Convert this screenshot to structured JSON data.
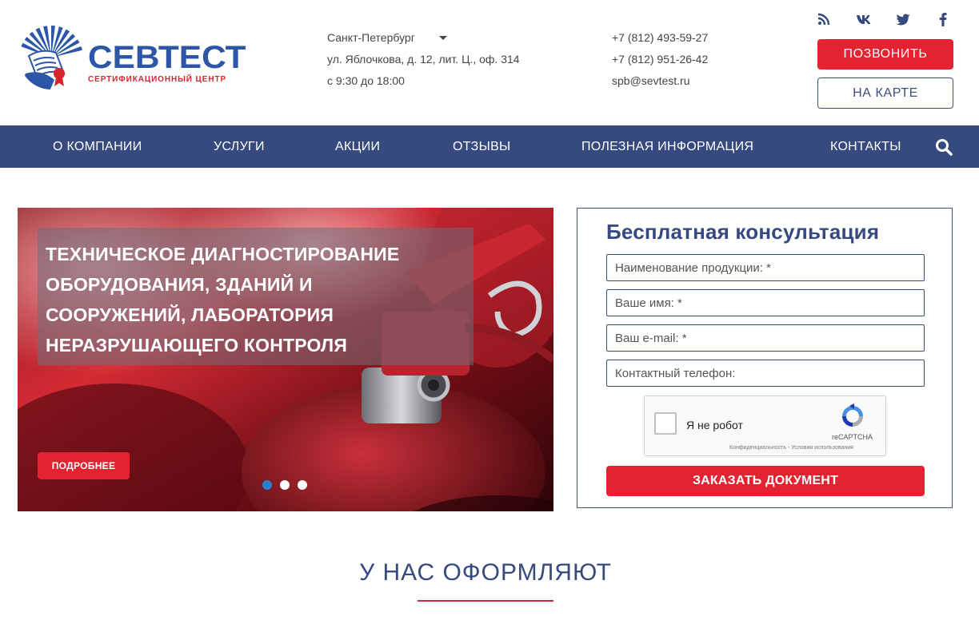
{
  "logo": {
    "name": "СЕВТЕСТ",
    "subtitle": "СЕРТИФИКАЦИОННЫЙ ЦЕНТР"
  },
  "header": {
    "city": "Санкт-Петербург",
    "address": "ул. Яблочкова, д. 12, лит. Ц., оф. 314",
    "hours": "с 9:30 до 18:00",
    "phone1": "+7 (812) 493-59-27",
    "phone2": "+7 (812) 951-26-42",
    "email": "spb@sevtest.ru",
    "call_button": "ПОЗВОНИТЬ",
    "map_button": "НА КАРТЕ",
    "socials": [
      "rss-icon",
      "vk-icon",
      "twitter-icon",
      "facebook-icon"
    ]
  },
  "nav": {
    "items": [
      "О КОМПАНИИ",
      "УСЛУГИ",
      "АКЦИИ",
      "ОТЗЫВЫ",
      "ПОЛЕЗНАЯ ИНФОРМАЦИЯ",
      "КОНТАКТЫ"
    ],
    "search_icon": "search-icon"
  },
  "slider": {
    "caption_lines": [
      "ТЕХНИЧЕСКОЕ ДИАГНОСТИРОВАНИЕ",
      "ОБОРУДОВАНИЯ, ЗДАНИЙ И",
      "СООРУЖЕНИЙ, ЛАБОРАТОРИЯ",
      "НЕРАЗРУШАЮЩЕГО КОНТРОЛЯ"
    ],
    "button": "ПОДРОБНЕЕ",
    "slide_count": 3,
    "active_slide": 1
  },
  "form": {
    "title": "Бесплатная консультация",
    "fields": {
      "product": "Наименование продукции: *",
      "name": "Ваше имя: *",
      "email": "Ваш e-mail: *",
      "phone": "Контактный телефон:"
    },
    "captcha": {
      "label": "Я не робот",
      "brand": "reCAPTCHA",
      "links": "Конфиденциальность - Условия использования"
    },
    "submit": "ЗАКАЗАТЬ ДОКУМЕНТ"
  },
  "section": {
    "title": "У НАС ОФОРМЛЯЮТ"
  },
  "colors": {
    "brand_blue": "#364a80",
    "accent_red": "#e52231",
    "logo_blue": "#2d57a6"
  }
}
